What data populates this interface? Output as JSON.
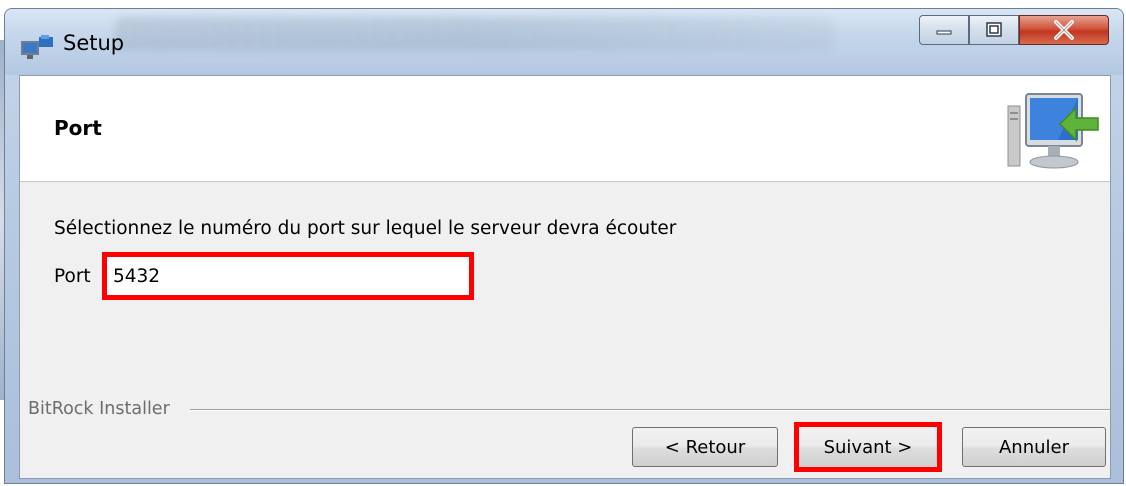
{
  "window": {
    "title": "Setup",
    "controls": {
      "minimize_icon": "minimize-icon",
      "maximize_icon": "maximize-icon",
      "close_icon": "close-icon",
      "close_glyph": "X"
    }
  },
  "header": {
    "title": "Port",
    "icon": "install-computer-icon"
  },
  "body": {
    "instruction": "Sélectionnez le numéro du port sur lequel le serveur devra écouter",
    "port_label": "Port",
    "port_value": "5432"
  },
  "footer": {
    "brand": "BitRock Installer",
    "back_label": "< Retour",
    "next_label": "Suivant >",
    "cancel_label": "Annuler"
  },
  "colors": {
    "highlight": "#ff0000",
    "client_bg": "#f0f0f0",
    "header_bg": "#ffffff"
  }
}
